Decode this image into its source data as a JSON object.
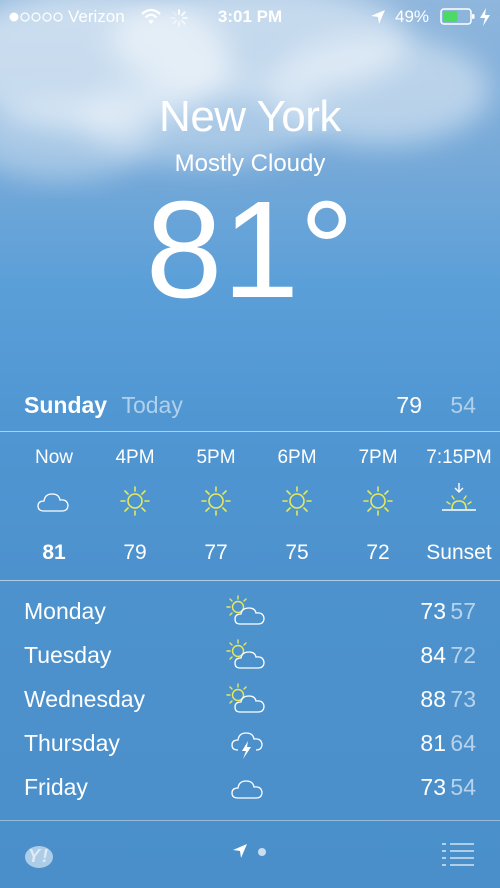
{
  "colors": {
    "sun": "#e6ea5a",
    "battery": "#4cd964"
  },
  "status": {
    "carrier": "Verizon",
    "time": "3:01 PM",
    "battery": "49%"
  },
  "location": {
    "city": "New York",
    "condition": "Mostly Cloudy",
    "temperature": "81°"
  },
  "today": {
    "day": "Sunday",
    "label": "Today",
    "high": "79",
    "low": "54"
  },
  "hourly": [
    {
      "time": "Now",
      "icon": "cloud-icon",
      "value": "81"
    },
    {
      "time": "4PM",
      "icon": "sun-icon",
      "value": "79"
    },
    {
      "time": "5PM",
      "icon": "sun-icon",
      "value": "77"
    },
    {
      "time": "6PM",
      "icon": "sun-icon",
      "value": "75"
    },
    {
      "time": "7PM",
      "icon": "sun-icon",
      "value": "72"
    },
    {
      "time": "7:15PM",
      "icon": "sunset-icon",
      "value": "Sunset"
    }
  ],
  "daily": [
    {
      "day": "Monday",
      "icon": "partly-cloudy-icon",
      "high": "73",
      "low": "57"
    },
    {
      "day": "Tuesday",
      "icon": "partly-cloudy-icon",
      "high": "84",
      "low": "72"
    },
    {
      "day": "Wednesday",
      "icon": "partly-cloudy-icon",
      "high": "88",
      "low": "73"
    },
    {
      "day": "Thursday",
      "icon": "thunderstorm-icon",
      "high": "81",
      "low": "64"
    },
    {
      "day": "Friday",
      "icon": "cloud-icon",
      "high": "73",
      "low": "54"
    }
  ],
  "footer": {
    "logo": "Y!"
  }
}
